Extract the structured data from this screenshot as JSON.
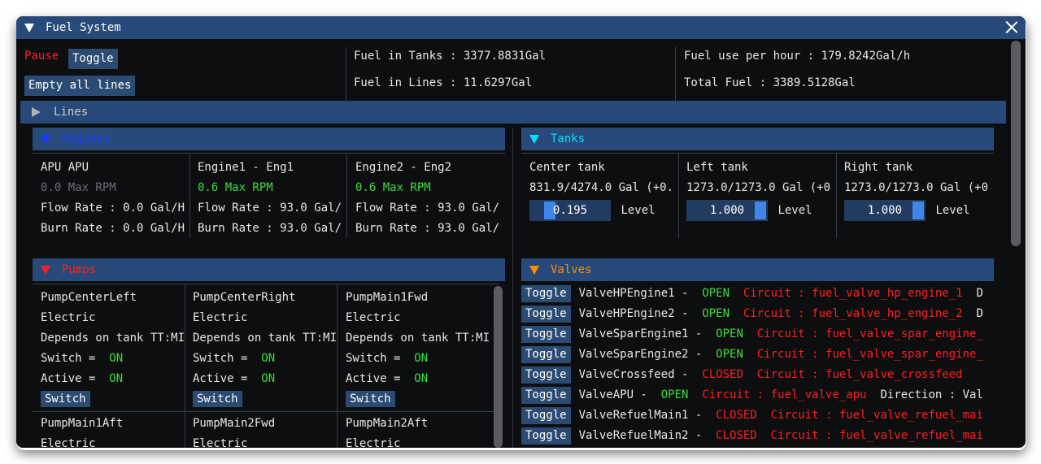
{
  "window": {
    "title": "Fuel System"
  },
  "top": {
    "pause_label": "Pause",
    "toggle_label": "Toggle",
    "empty_lines_label": "Empty all lines",
    "fuel_in_tanks": "Fuel in Tanks : 3377.8831Gal",
    "fuel_in_lines": "Fuel in Lines : 11.6297Gal",
    "fuel_use": "Fuel use per hour : 179.8242Gal/h",
    "total_fuel": "Total Fuel : 3389.5128Gal"
  },
  "lines_header": "Lines",
  "engines": {
    "header": "Engines",
    "header_color": "#1a3cff",
    "items": [
      {
        "name": "APU APU",
        "rpm": "0.0 Max RPM",
        "flow": "Flow Rate : 0.0 Gal/H",
        "burn": "Burn Rate : 0.0 Gal/H"
      },
      {
        "name": "Engine1 - Eng1",
        "rpm": "0.6 Max RPM",
        "flow": "Flow Rate : 93.0 Gal/",
        "burn": "Burn Rate : 93.0 Gal/"
      },
      {
        "name": "Engine2 - Eng2",
        "rpm": "0.6 Max RPM",
        "flow": "Flow Rate : 93.0 Gal/",
        "burn": "Burn Rate : 93.0 Gal/"
      }
    ]
  },
  "tanks": {
    "header": "Tanks",
    "header_color": "#00e0ff",
    "level_label": "Level",
    "items": [
      {
        "name": "Center tank",
        "amount": "831.9/4274.0 Gal (+0.",
        "level": "0.195",
        "level_fraction": 0.195
      },
      {
        "name": "Left tank",
        "amount": "1273.0/1273.0 Gal (+0",
        "level": "1.000",
        "level_fraction": 1.0
      },
      {
        "name": "Right tank",
        "amount": "1273.0/1273.0 Gal (+0",
        "level": "1.000",
        "level_fraction": 1.0
      }
    ]
  },
  "pumps": {
    "header": "Pumps",
    "header_color": "#ff1f1f",
    "switch_label": "Switch",
    "items": [
      {
        "name": "PumpCenterLeft",
        "type": "Electric",
        "depends": "Depends on tank TT:MI",
        "switch_text": "Switch =",
        "switch_val": "ON",
        "active_text": "Active =",
        "active_val": "ON"
      },
      {
        "name": "PumpCenterRight",
        "type": "Electric",
        "depends": "Depends on tank TT:MI",
        "switch_text": "Switch =",
        "switch_val": "ON",
        "active_text": "Active =",
        "active_val": "ON"
      },
      {
        "name": "PumpMain1Fwd",
        "type": "Electric",
        "depends": "Depends on tank TT:MI",
        "switch_text": "Switch =",
        "switch_val": "ON",
        "active_text": "Active =",
        "active_val": "ON"
      },
      {
        "name": "PumpMain1Aft",
        "type": "Electric"
      },
      {
        "name": "PumpMain2Fwd",
        "type": "Electric"
      },
      {
        "name": "PumpMain2Aft",
        "type": "Electric"
      }
    ]
  },
  "valves": {
    "header": "Valves",
    "header_color": "#ff8c00",
    "toggle_label": "Toggle",
    "items": [
      {
        "name": "ValveHPEngine1 -",
        "state": "OPEN",
        "circuit": "Circuit : fuel_valve_hp_engine_1",
        "extra": "D"
      },
      {
        "name": "ValveHPEngine2 -",
        "state": "OPEN",
        "circuit": "Circuit : fuel_valve_hp_engine_2",
        "extra": "D"
      },
      {
        "name": "ValveSparEngine1 -",
        "state": "OPEN",
        "circuit": "Circuit : fuel_valve_spar_engine_",
        "extra": ""
      },
      {
        "name": "ValveSparEngine2 -",
        "state": "OPEN",
        "circuit": "Circuit : fuel_valve_spar_engine_",
        "extra": ""
      },
      {
        "name": "ValveCrossfeed -",
        "state": "CLOSED",
        "circuit": "Circuit : fuel_valve_crossfeed",
        "extra": ""
      },
      {
        "name": "ValveAPU -",
        "state": "OPEN",
        "circuit": "Circuit : fuel_valve_apu",
        "extra": "Direction : Val"
      },
      {
        "name": "ValveRefuelMain1 -",
        "state": "CLOSED",
        "circuit": "Circuit : fuel_valve_refuel_mai",
        "extra": ""
      },
      {
        "name": "ValveRefuelMain2 -",
        "state": "CLOSED",
        "circuit": "Circuit : fuel_valve_refuel_mai",
        "extra": ""
      }
    ]
  },
  "colors": {
    "titlebar": "#284a7a",
    "button": "#2c4b73",
    "on": "#3ddc3d",
    "closed": "#ff1f1f"
  }
}
